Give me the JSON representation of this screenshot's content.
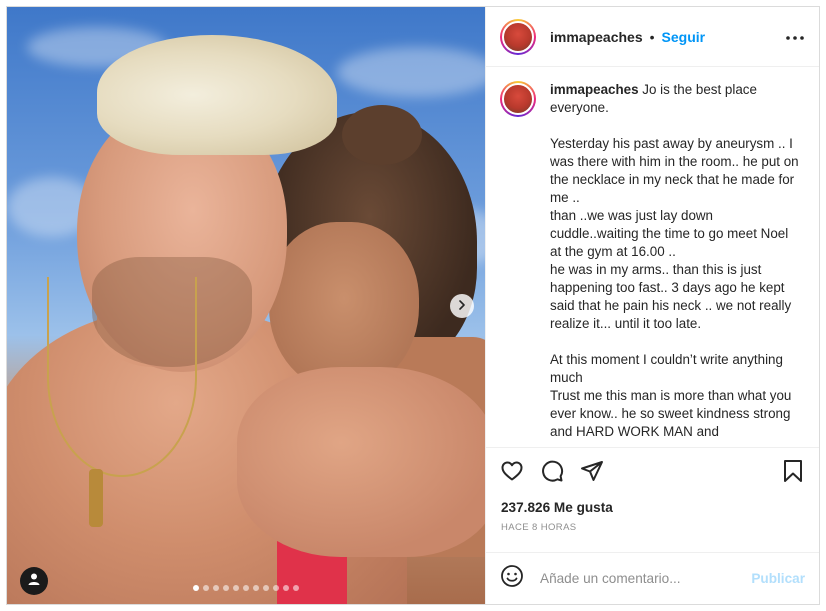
{
  "post": {
    "username": "immapeaches",
    "separator": "•",
    "follow_label": "Seguir",
    "caption_username": "immapeaches",
    "caption_text": " Jo is the best place everyone.\n\nYesterday his past away by aneurysm .. I was there with him in the room.. he put on the necklace in my neck that he made for me ..\nthan ..we was just lay down cuddle..waiting the time to go meet Noel at the gym at 16.00 ..\nhe was in my arms.. than this is just happening too fast.. 3 days ago he kept said that he pain his neck .. we not really realize it... until it too late.\n\nAt this moment I couldn’t write anything much\nTrust me this man is more than what you ever know.. he so sweet kindness strong and HARD WORK MAN and",
    "likes": "237.826 Me gusta",
    "time_ago": "HACE 8 HORAS",
    "comment_placeholder": "Añade un comentario...",
    "publish_label": "Publicar"
  },
  "carousel": {
    "total_slides": 11,
    "active_index": 0
  },
  "icons": {
    "more": "more-horizontal-icon",
    "like": "heart-icon",
    "comment": "comment-icon",
    "share": "paper-plane-icon",
    "save": "bookmark-icon",
    "emoji": "smiley-icon",
    "next": "chevron-right-icon",
    "tag": "user-tag-icon"
  },
  "colors": {
    "follow": "#0095f6",
    "publish_disabled": "#b2dffc",
    "muted": "#8e8e8e",
    "text": "#262626"
  }
}
